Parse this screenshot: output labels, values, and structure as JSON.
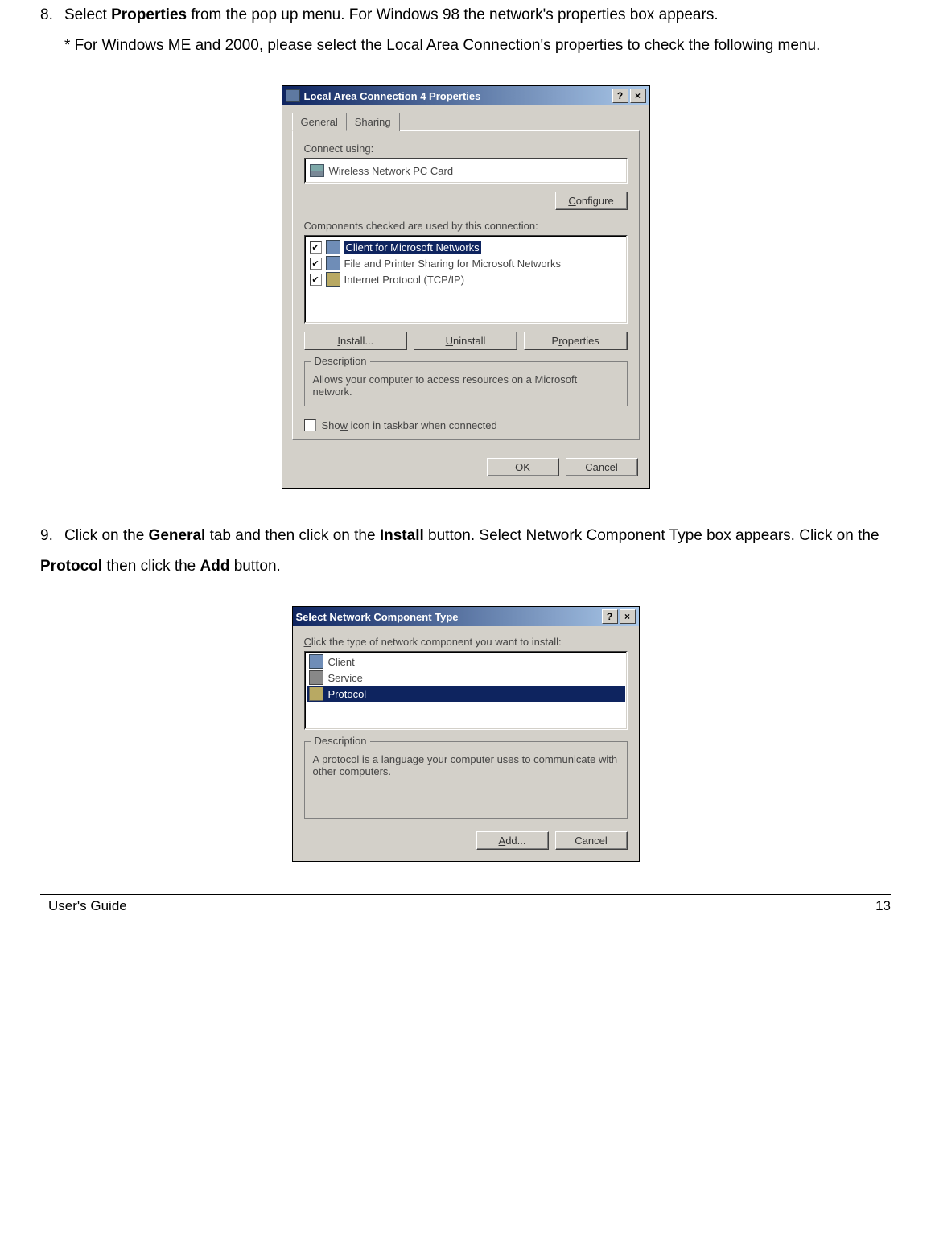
{
  "step8": {
    "num": "8.",
    "text_before": "Select ",
    "bold1": "Properties",
    "text_after": " from the pop up menu. For Windows 98 the network's properties box appears.",
    "note": "* For Windows ME and 2000, please select the Local Area Connection's properties to check the following menu."
  },
  "dialog1": {
    "title": "Local Area Connection 4 Properties",
    "help_btn": "?",
    "close_btn": "×",
    "tabs": {
      "general": "General",
      "sharing": "Sharing"
    },
    "connect_using_label": "Connect using:",
    "adapter": "Wireless Network PC Card",
    "configure_btn": "Configure",
    "components_label": "Components checked are used by this connection:",
    "components": [
      {
        "label": "Client for Microsoft Networks",
        "selected": true
      },
      {
        "label": "File and Printer Sharing for Microsoft Networks",
        "selected": false
      },
      {
        "label": "Internet Protocol (TCP/IP)",
        "selected": false
      }
    ],
    "install_btn": "Install...",
    "uninstall_btn": "Uninstall",
    "properties_btn": "Properties",
    "description_legend": "Description",
    "description_text": "Allows your computer to access resources on a Microsoft network.",
    "show_icon_label": "Show icon in taskbar when connected",
    "ok_btn": "OK",
    "cancel_btn": "Cancel"
  },
  "step9": {
    "num": "9.",
    "p1": "Click on the ",
    "b1": "General",
    "p2": " tab and then click on the ",
    "b2": "Install",
    "p3": " button. Select Network Component Type box appears. Click on the ",
    "b3": "Protocol",
    "p4": " then click the ",
    "b4": "Add",
    "p5": " button."
  },
  "dialog2": {
    "title": "Select Network Component Type",
    "help_btn": "?",
    "close_btn": "×",
    "prompt": "Click the type of network component you want to install:",
    "items": [
      {
        "label": "Client",
        "type": "client",
        "selected": false
      },
      {
        "label": "Service",
        "type": "service",
        "selected": false
      },
      {
        "label": "Protocol",
        "type": "protocol",
        "selected": true
      }
    ],
    "description_legend": "Description",
    "description_text": "A protocol is a language your computer uses to communicate with other computers.",
    "add_btn": "Add...",
    "cancel_btn": "Cancel"
  },
  "footer": {
    "left": "User's Guide",
    "right": "13"
  }
}
